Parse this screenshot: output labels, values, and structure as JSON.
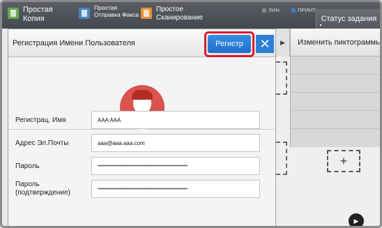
{
  "topbar": {
    "simple_copy_label": "Простая\nКопия",
    "simple_fax_label": "Простая\nОтправка Факса",
    "simple_scan_label": "Простое\nСканирование",
    "line_indicator": "ЛИН.",
    "print_indicator": "ПРИНТ",
    "job_status_label": "Статус задания"
  },
  "dialog": {
    "title": "Регистрация Имени Пользователя",
    "register_label": "Регистр",
    "close_glyph": "✕",
    "fields": [
      {
        "label": "Регистрац. Имя",
        "value": "AAA AAA"
      },
      {
        "label": "Адрес Эл.Почты",
        "value": "aaa@aaa.aaa.com"
      },
      {
        "label": "Пароль",
        "value": "••••••••••••••••••••••••••••••••••••••••••••••••••••••••••••••••••"
      },
      {
        "label": "Пароль\n(подтверждение)",
        "value": "••••••••••••••••••••••••••••••••••••••••••••••••••••••••••••••••••"
      }
    ]
  },
  "background": {
    "side_arrow_glyph": "▶",
    "change_icons_label": "Изменить пиктограммы",
    "plus_glyph": "+",
    "next_glyph": "▶"
  },
  "colors": {
    "accent_blue": "#2c7fd6",
    "highlight_red": "#e0192b",
    "avatar_red": "#d9534f"
  }
}
